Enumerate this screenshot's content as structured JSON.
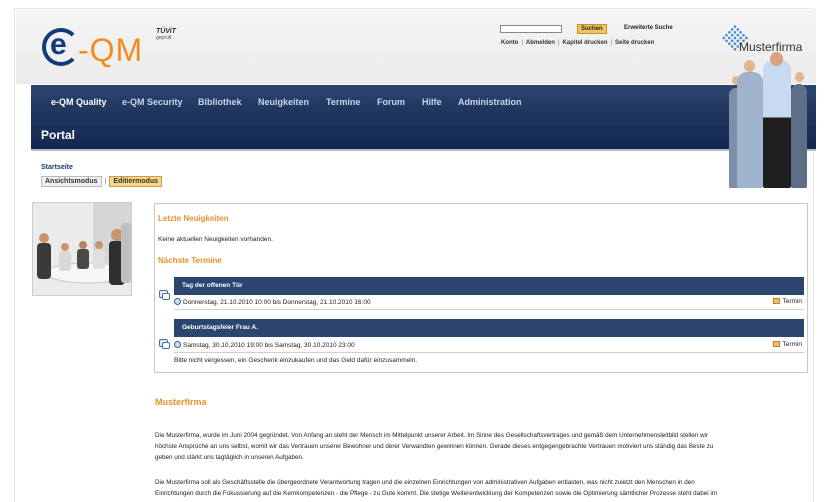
{
  "header": {
    "logo_left": "e",
    "logo_right": "-QM",
    "tuev_label": "TÜViT",
    "tuev_sub": "geprüft",
    "search_button": "Suchen",
    "advanced_search": "Erweiterte Suche",
    "top_links": [
      "Konto",
      "Abmelden",
      "Kapitel drucken",
      "Seite drucken"
    ],
    "brand_name": "Musterfirma"
  },
  "nav": {
    "items": [
      "e-QM Quality",
      "e-QM Security",
      "Bibliothek",
      "Neuigkeiten",
      "Termine",
      "Forum",
      "Hilfe",
      "Administration"
    ]
  },
  "portal": {
    "title": "Portal"
  },
  "breadcrumb": "Startseite",
  "modes": {
    "view": "Ansichtsmodus",
    "edit": "Editiermodus"
  },
  "news": {
    "title": "Letzte Neuigkeiten",
    "empty": "Keine aktuellen Neuigkeiten vorhanden."
  },
  "events": {
    "title": "Nächste Termine",
    "items": [
      {
        "name": "Tag der offenen Tür",
        "date": "Donnerstag, 21.10.2010 10:00 bis Donnerstag, 21.10.2010 16:00",
        "type": "Termin",
        "note": ""
      },
      {
        "name": "Geburtstagsfeier Frau A.",
        "date": "Samstag, 30.10.2010 19:00 bis Samstag, 30.10.2010 23:00",
        "type": "Termin",
        "note": "Bitte nicht vergessen, ein Geschenk einzukaufen und das Geld dafür einzusammeln."
      }
    ]
  },
  "firm": {
    "title": "Musterfirma",
    "para1_lines": [
      "Die Musterfirma, wurde im Juni 2004 gegründet. Von Anfang an steht der Mensch im Mittelpunkt unserer Arbeit. Im Sinne des Gesellschaftsvertrages und gemäß dem Unternehmensleitbild stellen wir",
      "höchste Ansprüche an uns selbst, womit wir das Vertrauen unserer Bewohner und derer Verwandten gewinnen können. Gerade dieses entgegengebrachte Vertrauen motiviert uns ständig das Beste zu",
      "geben und stärkt uns tagtäglich in unseren Aufgaben."
    ],
    "para2_lines": [
      "Die Musterfirma soll als Geschäftsstelle die übergeordnete Verantwortung tragen und die einzelnen Einrichtungen von administrativen Aufgaben entlasten, was nicht zuletzt den Menschen in den",
      "Einrichtungen durch die Fokussierung auf die Kernkompetenzen - die Pflege - zu Gute kommt. Die stetige Weiterentwicklung der Kompetenzen sowie die Optimierung sämtlicher Prozesse steht dabei im"
    ]
  },
  "colors": {
    "nav": "#1b3058",
    "accent": "#e8922e",
    "logo_blue": "#123a78",
    "logo_orange": "#f28c1e"
  }
}
